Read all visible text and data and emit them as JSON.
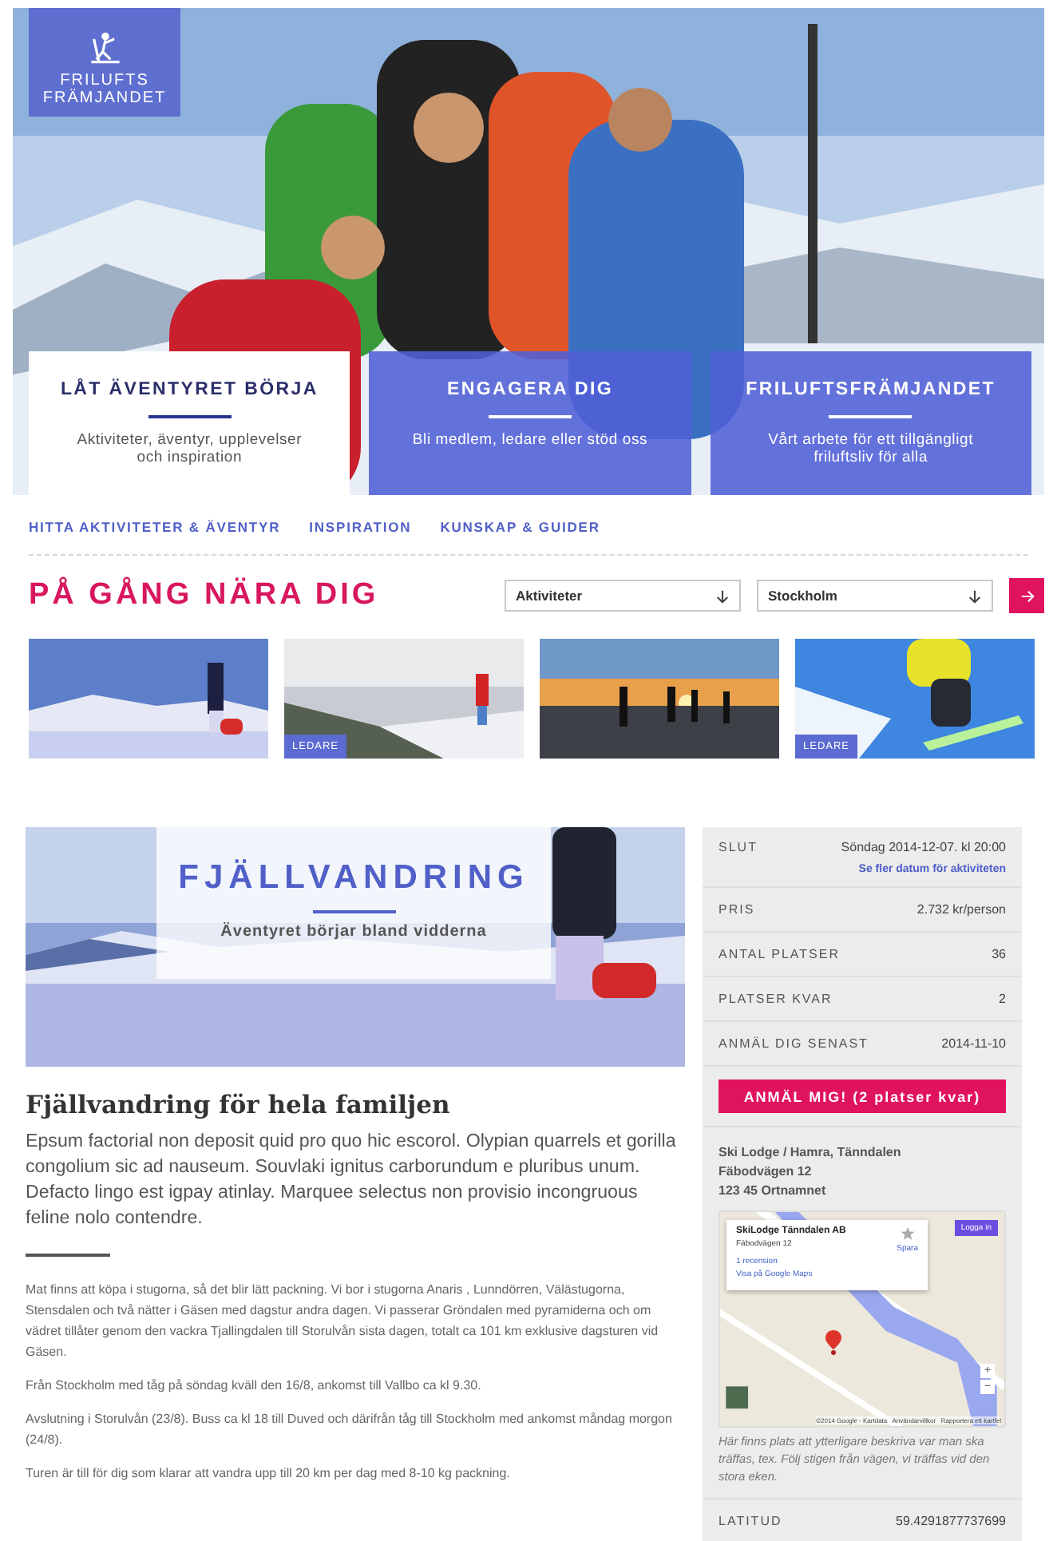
{
  "logo": {
    "lines": [
      "FRILUFTS",
      "FRÄMJANDET"
    ]
  },
  "hero_cards": [
    {
      "kind": "light",
      "title": "LÅT ÄVENTYRET BÖRJA",
      "subtitle": "Aktiviteter, äventyr, upplevelser och inspiration"
    },
    {
      "kind": "blue",
      "title": "ENGAGERA DIG",
      "subtitle": "Bli medlem, ledare eller stöd oss"
    },
    {
      "kind": "blue",
      "title": "FRILUFTSFRÄMJANDET",
      "subtitle": "Vårt arbete för ett tillgängligt friluftsliv för alla"
    }
  ],
  "nav": {
    "items": [
      "HITTA AKTIVITETER & ÄVENTYR",
      "INSPIRATION",
      "KUNSKAP & GUIDER"
    ]
  },
  "nearby": {
    "title": "PÅ GÅNG NÄRA DIG",
    "filters": [
      {
        "value": "Aktiviteter"
      },
      {
        "value": "Stockholm"
      }
    ],
    "thumbnails": [
      {
        "kind": "hiker"
      },
      {
        "kind": "valley",
        "badge": "LEDARE"
      },
      {
        "kind": "sunset"
      },
      {
        "kind": "snowboard",
        "badge": "LEDARE"
      }
    ]
  },
  "activity": {
    "banner_title": "FJÄLLVANDRING",
    "banner_subtitle": "Äventyret börjar bland vidderna",
    "heading": "Fjällvandring för hela familjen",
    "lead": "Epsum factorial non deposit quid pro quo hic escorol. Olypian quarrels et gorilla congolium sic ad nauseum. Souvlaki ignitus carborundum e pluribus unum. Defacto lingo est igpay atinlay. Marquee selectus non provisio incongruous feline nolo contendre.",
    "paragraphs": [
      "Mat finns att köpa i stugorna, så det blir lätt packning. Vi bor i stugorna Anaris , Lunndörren, Välästugorna, Stensdalen och två nätter i Gäsen med dagstur andra dagen. Vi passerar Gröndalen med pyramiderna och om vädret tillåter genom den vackra Tjallingdalen till Storulvån sista dagen, totalt ca 101 km exklusive dagsturen vid Gäsen.",
      "Från Stockholm med tåg på söndag kväll den 16/8, ankomst till Vallbo ca kl 9.30.",
      "Avslutning i Storulvån (23/8). Buss ca kl 18 till Duved och därifrån tåg till Stockholm med ankomst måndag morgon (24/8).",
      "Turen är till för dig som klarar att vandra upp till 20 km per dag med 8-10 kg packning."
    ]
  },
  "details": {
    "rows": [
      {
        "label": "SLUT",
        "value": "Söndag 2014-12-07. kl 20:00",
        "link": "Se fler datum för aktiviteten"
      },
      {
        "label": "PRIS",
        "value": "2.732 kr/person"
      },
      {
        "label": "ANTAL PLATSER",
        "value": "36"
      },
      {
        "label": "PLATSER KVAR",
        "value": "2"
      },
      {
        "label": "ANMÄL DIG SENAST",
        "value": "2014-11-10"
      }
    ],
    "signup_button": "ANMÄL MIG! (2 platser kvar)",
    "address": [
      "Ski Lodge / Hamra, Tänndalen",
      "Fäbodvägen 12",
      "123 45 Ortnamnet"
    ],
    "map": {
      "info_title": "SkiLodge Tänndalen AB",
      "info_address": "Fäbodvägen 12",
      "info_reviews": "1 recension",
      "info_link": "Visa på Google Maps",
      "save": "Spara",
      "login": "Logga in",
      "zoom_in": "+",
      "zoom_out": "−",
      "attribution": "©2014 Google - Kartdata   Användarvillkor   Rapportera ett kartfel"
    },
    "note": "Här finns plats att ytterligare beskriva var man ska träffas, tex. Följ stigen från vägen, vi träffas vid den stora eken.",
    "latitude": {
      "label": "LATITUD",
      "value": "59.4291877737699"
    }
  }
}
